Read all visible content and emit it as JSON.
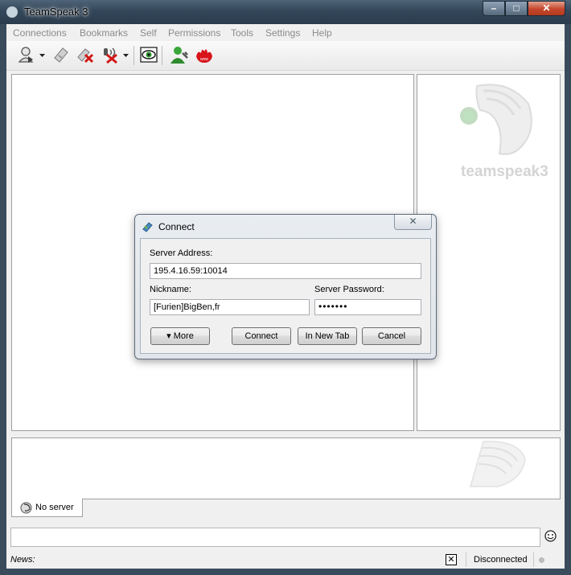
{
  "window": {
    "title": "TeamSpeak 3"
  },
  "menu": {
    "items": [
      "Connections",
      "Bookmarks",
      "Self",
      "Permissions",
      "Tools",
      "Settings",
      "Help"
    ]
  },
  "info_panel": {
    "logo_text": "teamspeak3"
  },
  "tab": {
    "label": "No server"
  },
  "status_bar": {
    "news_label": "News:",
    "close_glyph": "✕",
    "state": "Disconnected"
  },
  "dialog": {
    "title": "Connect",
    "close_glyph": "✕",
    "server_address_label": "Server Address:",
    "server_address_value": "195.4.16.59:10014",
    "nickname_label": "Nickname:",
    "nickname_value": "[Furien]BigBen,fr",
    "password_label": "Server Password:",
    "password_value": "•••••••",
    "more_button": "▾ More",
    "connect_button": "Connect",
    "new_tab_button": "In New Tab",
    "cancel_button": "Cancel"
  },
  "icons": {
    "toolbar": [
      "connect-icon",
      "dropdown-arrow-icon",
      "disconnect-icon",
      "disconnect-all-icon",
      "mute-microphone-icon",
      "dropdown-arrow-icon",
      "away-icon",
      "contacts-icon",
      "kill-icon"
    ],
    "dialog": "connect-icon",
    "tab": "teamspeak-icon",
    "chat": "smiley-icon"
  },
  "colors": {
    "titlebar": "#34475a",
    "close_button": "#c4462b",
    "accent_green": "#2e8b2e",
    "accent_red": "#d8141a"
  }
}
